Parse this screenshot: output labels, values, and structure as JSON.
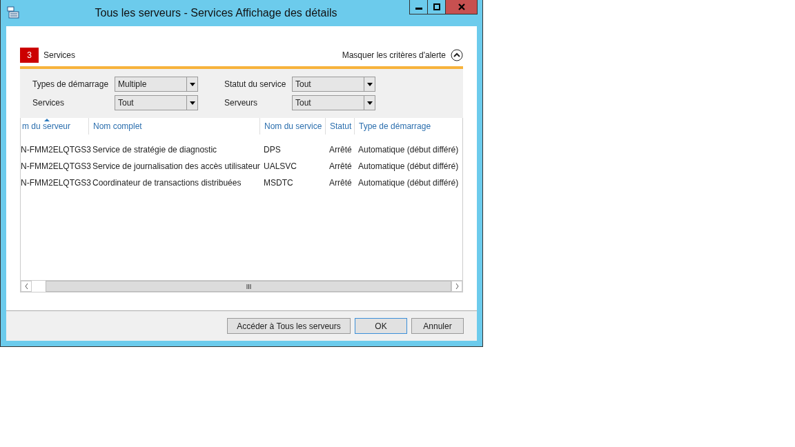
{
  "window": {
    "title": "Tous les serveurs - Services Affichage des détails"
  },
  "header": {
    "count": "3",
    "label": "Services",
    "toggle": "Masquer les critères d'alerte"
  },
  "filters": [
    {
      "label": "Types de démarrage",
      "value": "Multiple"
    },
    {
      "label": "Statut du service",
      "value": "Tout"
    },
    {
      "label": "Services",
      "value": "Tout"
    },
    {
      "label": "Serveurs",
      "value": "Tout"
    }
  ],
  "table": {
    "columns": [
      {
        "label": "m du serveur",
        "sorted": true
      },
      {
        "label": "Nom complet",
        "sorted": false
      },
      {
        "label": "Nom du service",
        "sorted": false
      },
      {
        "label": "Statut",
        "sorted": false
      },
      {
        "label": "Type de démarrage",
        "sorted": false
      }
    ],
    "rows": [
      [
        "N-FMM2ELQTGS3",
        "Service de stratégie de diagnostic",
        "DPS",
        "Arrêté",
        "Automatique (début différé)"
      ],
      [
        "N-FMM2ELQTGS3",
        "Service de journalisation des accès utilisateur",
        "UALSVC",
        "Arrêté",
        "Automatique (début différé)"
      ],
      [
        "N-FMM2ELQTGS3",
        "Coordinateur de transactions distribuées",
        "MSDTC",
        "Arrêté",
        "Automatique (début différé)"
      ]
    ]
  },
  "buttons": [
    {
      "label": "Accéder à Tous les serveurs",
      "default": false
    },
    {
      "label": "OK",
      "default": true
    },
    {
      "label": "Annuler",
      "default": false
    }
  ]
}
